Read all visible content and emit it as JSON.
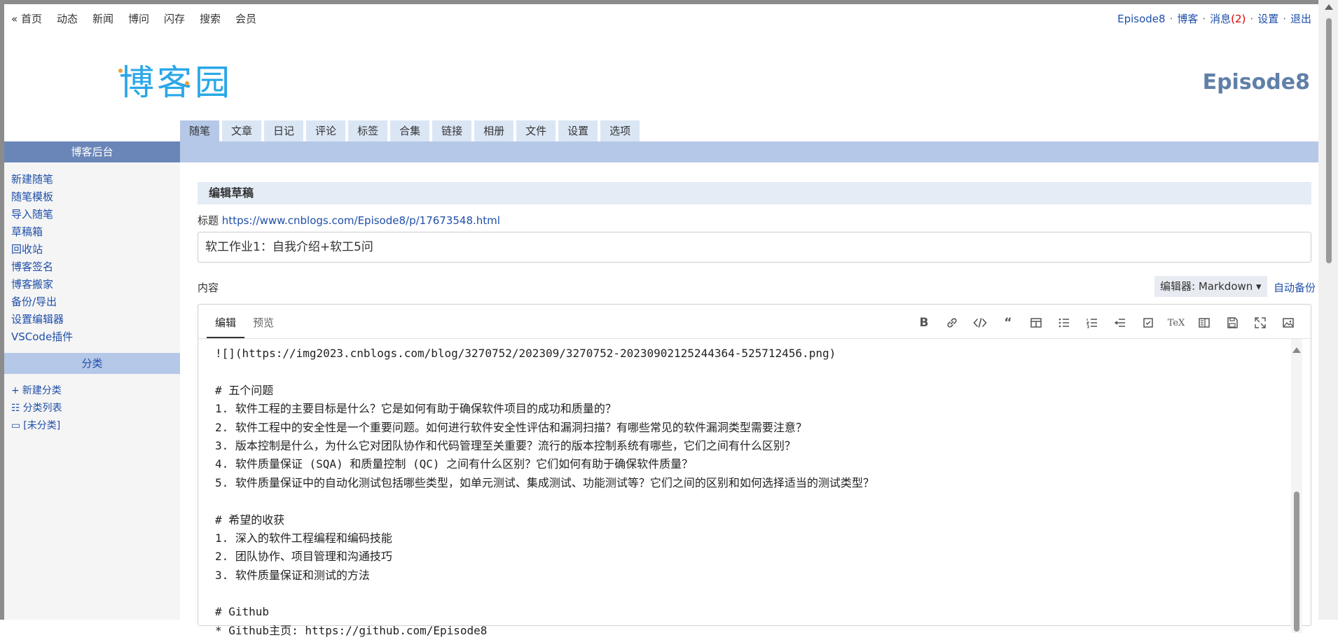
{
  "topnav": {
    "items": [
      "« 首页",
      "动态",
      "新闻",
      "博问",
      "闪存",
      "搜索",
      "会员"
    ]
  },
  "userbar": {
    "user": "Episode8",
    "blog": "博客",
    "messages": "消息",
    "msg_count": "(2)",
    "settings": "设置",
    "logout": "退出",
    "sep": "·"
  },
  "logo": {
    "text": "博客园"
  },
  "header": {
    "site_user": "Episode8"
  },
  "tabs": [
    "随笔",
    "文章",
    "日记",
    "评论",
    "标签",
    "合集",
    "链接",
    "相册",
    "文件",
    "设置",
    "选项"
  ],
  "sidebar": {
    "title": "博客后台",
    "links": [
      "新建随笔",
      "随笔模板",
      "导入随笔",
      "草稿箱",
      "回收站",
      "博客签名",
      "博客搬家",
      "备份/导出",
      "设置编辑器",
      "VSCode插件"
    ],
    "cat_title": "分类",
    "cat_links": [
      {
        "icon": "+",
        "label": "新建分类"
      },
      {
        "icon": "☷",
        "label": "分类列表"
      },
      {
        "icon": "▭",
        "label": "[未分类]"
      }
    ]
  },
  "main": {
    "section_title": "编辑草稿",
    "title_label": "标题",
    "title_link": "https://www.cnblogs.com/Episode8/p/17673548.html",
    "title_value": "软工作业1：自我介绍+软工5问",
    "content_label": "内容",
    "editor_select": "编辑器: Markdown ▾",
    "autosave": "自动备份"
  },
  "editor": {
    "tabs": [
      "编辑",
      "预览"
    ],
    "toolbar": [
      "bold-icon",
      "link-icon",
      "code-icon",
      "quote-icon",
      "table-icon",
      "bullet-list-icon",
      "ordered-list-icon",
      "indent-icon",
      "checkbox-icon",
      "tex-icon",
      "toc-icon",
      "save-icon",
      "fullscreen-icon",
      "image-icon"
    ],
    "lines": [
      "![](https://img2023.cnblogs.com/blog/3270752/202309/3270752-20230902125244364-525712456.png)",
      "",
      "# 五个问题",
      "1. 软件工程的主要目标是什么？它是如何有助于确保软件项目的成功和质量的？",
      "2. 软件工程中的安全性是一个重要问题。如何进行软件安全性评估和漏洞扫描？有哪些常见的软件漏洞类型需要注意？",
      "3. 版本控制是什么，为什么它对团队协作和代码管理至关重要？流行的版本控制系统有哪些，它们之间有什么区别？",
      "4. 软件质量保证 (SQA) 和质量控制 (QC) 之间有什么区别？它们如何有助于确保软件质量？",
      "5. 软件质量保证中的自动化测试包括哪些类型，如单元测试、集成测试、功能测试等？它们之间的区别和如何选择适当的测试类型？",
      "",
      "# 希望的收获",
      "1. 深入的软件工程编程和编码技能",
      "2. 团队协作、项目管理和沟通技巧",
      "3. 软件质量保证和测试的方法",
      "",
      "# Github",
      "* Github主页: https://github.com/Episode8"
    ]
  },
  "colors": {
    "accent": "#1f4fa8",
    "tab_bg": "#dbe6f5",
    "tab_active": "#b6c8e8",
    "sidebar_head": "#6a86b8",
    "logo": "#2aa7e8"
  }
}
